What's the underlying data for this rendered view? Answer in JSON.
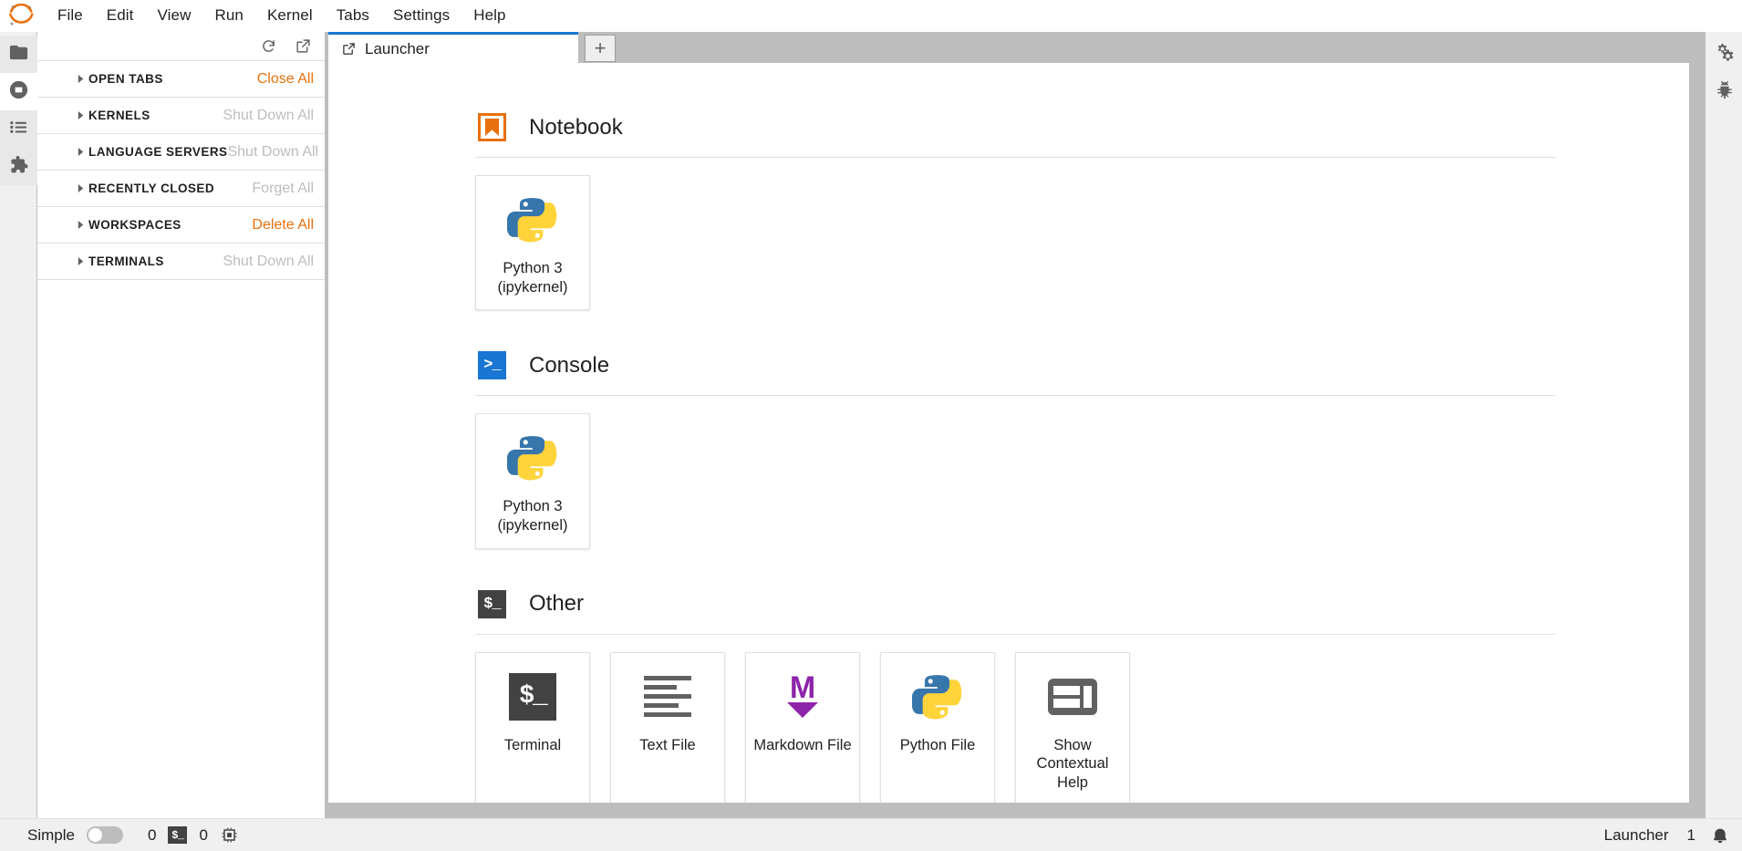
{
  "app": {
    "logo_icon": "jupyter-logo-icon",
    "menus": [
      "File",
      "Edit",
      "View",
      "Run",
      "Kernel",
      "Tabs",
      "Settings",
      "Help"
    ]
  },
  "left_activity_bar": {
    "items": [
      {
        "name": "file-browser",
        "icon": "folder-icon",
        "state": "tinted"
      },
      {
        "name": "running-terminals-kernels",
        "icon": "stop-circle-icon",
        "state": "active"
      },
      {
        "name": "command-palette",
        "icon": "list-icon",
        "state": "tinted"
      },
      {
        "name": "extension-manager",
        "icon": "puzzle-icon",
        "state": "tinted"
      }
    ]
  },
  "left_panel": {
    "toolbar": [
      {
        "name": "refresh-button",
        "icon": "refresh-icon"
      },
      {
        "name": "new-launcher-button",
        "icon": "external-link-icon"
      }
    ],
    "sections": [
      {
        "title": "OPEN TABS",
        "action": "Close All",
        "action_enabled": true
      },
      {
        "title": "KERNELS",
        "action": "Shut Down All",
        "action_enabled": false
      },
      {
        "title": "LANGUAGE SERVERS",
        "action": "Shut Down All",
        "action_enabled": false
      },
      {
        "title": "RECENTLY CLOSED",
        "action": "Forget All",
        "action_enabled": false
      },
      {
        "title": "WORKSPACES",
        "action": "Delete All",
        "action_enabled": true
      },
      {
        "title": "TERMINALS",
        "action": "Shut Down All",
        "action_enabled": false
      }
    ]
  },
  "tabbar": {
    "tabs": [
      {
        "label": "Launcher",
        "icon": "launcher-icon",
        "active": true
      }
    ],
    "add_tab_label": "+"
  },
  "launcher": {
    "sections": [
      {
        "title": "Notebook",
        "icon": "notebook-icon",
        "cards": [
          {
            "label": "Python 3 (ipykernel)",
            "icon": "python-logo-icon"
          }
        ]
      },
      {
        "title": "Console",
        "icon": "console-icon",
        "cards": [
          {
            "label": "Python 3 (ipykernel)",
            "icon": "python-logo-icon"
          }
        ]
      },
      {
        "title": "Other",
        "icon": "terminal-icon",
        "cards": [
          {
            "label": "Terminal",
            "icon": "terminal-icon"
          },
          {
            "label": "Text File",
            "icon": "text-file-icon"
          },
          {
            "label": "Markdown File",
            "icon": "markdown-icon"
          },
          {
            "label": "Python File",
            "icon": "python-logo-icon"
          },
          {
            "label": "Show Contextual Help",
            "icon": "inspector-icon"
          }
        ]
      }
    ]
  },
  "right_activity_bar": {
    "items": [
      {
        "name": "property-inspector",
        "icon": "gears-icon"
      },
      {
        "name": "debugger",
        "icon": "bug-icon"
      }
    ]
  },
  "statusbar": {
    "simple_label": "Simple",
    "simple_enabled": false,
    "kernel_count": "0",
    "terminal_badge": "$_",
    "terminal_count": "0",
    "resource_icon": "chip-icon",
    "active_tab": "Launcher",
    "notification_count": "1",
    "notification_icon": "bell-icon"
  },
  "colors": {
    "brand_orange": "#e8700d",
    "accent_blue": "#1976d2",
    "markdown_purple": "#8e24aa",
    "python_blue": "#3776ab",
    "python_yellow": "#ffd43b",
    "chrome_gray": "#bdbdbd",
    "panel_gray": "#f0f0f0"
  }
}
